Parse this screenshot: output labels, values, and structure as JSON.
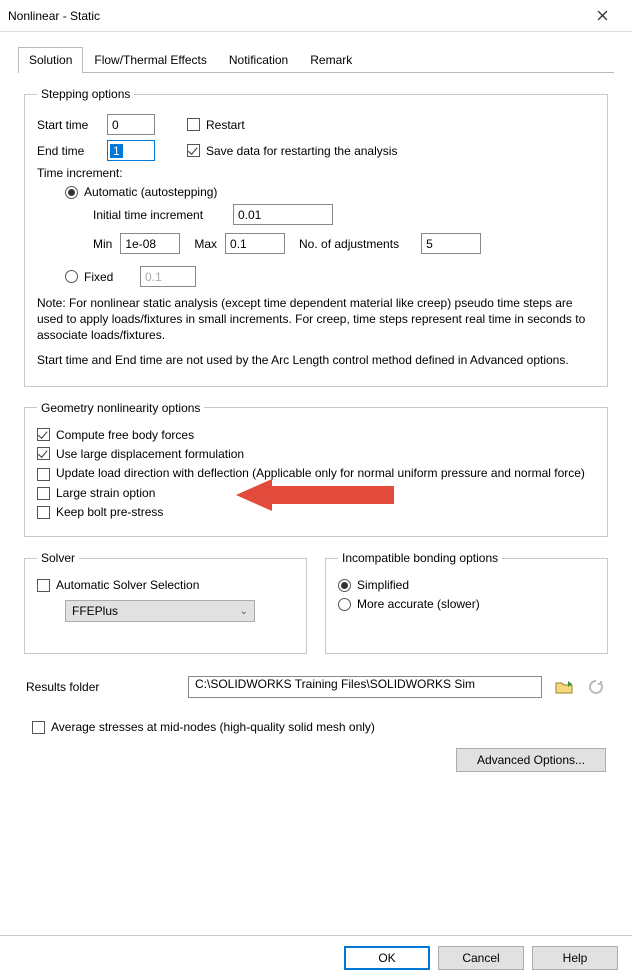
{
  "window": {
    "title": "Nonlinear - Static"
  },
  "tabs": [
    "Solution",
    "Flow/Thermal Effects",
    "Notification",
    "Remark"
  ],
  "stepping": {
    "legend": "Stepping options",
    "start_label": "Start time",
    "start_val": "0",
    "end_label": "End time",
    "end_val": "1",
    "restart_label": "Restart",
    "save_label": "Save data for restarting the analysis",
    "time_inc_label": "Time increment:",
    "auto_label": "Automatic (autostepping)",
    "init_label": "Initial time increment",
    "init_val": "0.01",
    "min_label": "Min",
    "min_val": "1e-08",
    "max_label": "Max",
    "max_val": "0.1",
    "adj_label": "No. of adjustments",
    "adj_val": "5",
    "fixed_label": "Fixed",
    "fixed_val": "0.1",
    "note1": "Note: For nonlinear static analysis (except time dependent material like creep) pseudo time steps are used to apply loads/fixtures in small increments. For creep, time steps represent real time in seconds to associate loads/fixtures.",
    "note2": "Start time and End time  are not used by the Arc Length control method defined in Advanced options."
  },
  "geom": {
    "legend": "Geometry nonlinearity options",
    "free_body": "Compute free body forces",
    "large_disp": "Use large displacement formulation",
    "update_load": "Update load direction with deflection (Applicable only for normal uniform pressure and normal force)",
    "large_strain": "Large strain option",
    "bolt": "Keep bolt pre-stress"
  },
  "solver": {
    "legend": "Solver",
    "auto_label": "Automatic Solver Selection",
    "selected": "FFEPlus"
  },
  "incompat": {
    "legend": "Incompatible bonding options",
    "simple": "Simplified",
    "accurate": "More accurate (slower)"
  },
  "results": {
    "label": "Results folder",
    "path": "C:\\SOLIDWORKS Training Files\\SOLIDWORKS Sim"
  },
  "avg_label": "Average stresses at mid-nodes (high-quality solid mesh only)",
  "adv_label": "Advanced Options...",
  "buttons": {
    "ok": "OK",
    "cancel": "Cancel",
    "help": "Help"
  }
}
